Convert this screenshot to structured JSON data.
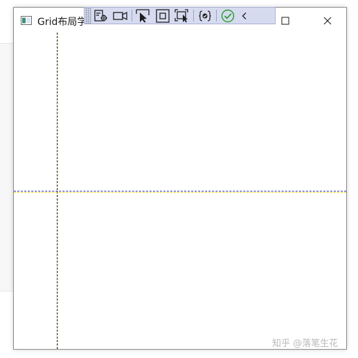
{
  "window": {
    "title": "Grid布局学"
  },
  "toolbar": {
    "items": [
      "live-visual-tree-icon",
      "preview-camera-icon",
      "select-element-icon",
      "display-layout-adorners-icon",
      "track-focus-icon",
      "binding-failures-icon",
      "hot-reload-ok-icon",
      "collapse-chevron-icon"
    ]
  },
  "grid_lines": {
    "primary_color": "#2b2ba8",
    "secondary_color": "#e5d21a"
  },
  "watermark": "知乎 @落笔生花"
}
